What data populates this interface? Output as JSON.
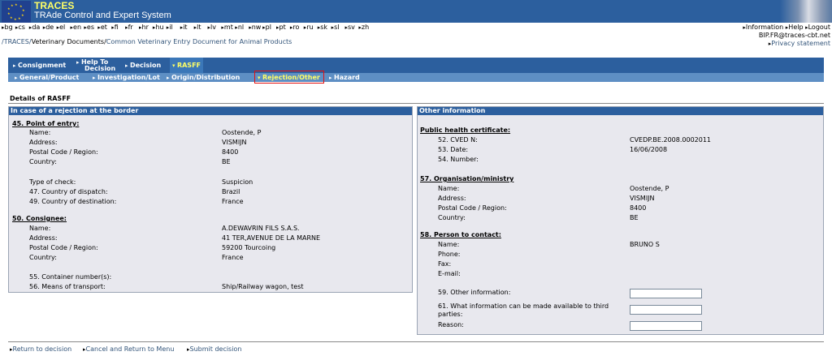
{
  "header": {
    "app_name": "TRACES",
    "app_subtitle": "TRAde Control and Expert System"
  },
  "languages": [
    "bg",
    "cs",
    "da",
    "de",
    "el",
    "en",
    "es",
    "et",
    "fi",
    "fr",
    "hr",
    "hu",
    "il",
    "it",
    "lt",
    "lv",
    "mt",
    "nl",
    "nw",
    "pl",
    "pt",
    "ro",
    "ru",
    "sk",
    "sl",
    "sv",
    "zh"
  ],
  "top_links": {
    "information": "Information",
    "help": "Help",
    "logout": "Logout",
    "user_email": "BIP.FR@traces-cbt.net",
    "privacy": "Privacy statement"
  },
  "breadcrumb": {
    "root": "/TRACES/",
    "section": "Veterinary Documents",
    "sep": "/",
    "page": "Common Veterinary Entry Document for Animal Products"
  },
  "tabs": {
    "consignment": "Consignment",
    "help_line1": "Help To",
    "help_line2": "Decision",
    "decision": "Decision",
    "rasff": "RASFF"
  },
  "subtabs": {
    "general": "General/Product",
    "investigation": "Investigation/Lot",
    "origin": "Origin/Distribution",
    "rejection": "Rejection/Other",
    "hazard": "Hazard"
  },
  "section_title": "Details of RASFF",
  "left_panel": {
    "title": "In case of a rejection at the border",
    "point_of_entry": {
      "heading": "45. Point of entry:",
      "name_label": "Name:",
      "name_value": "Oostende, P",
      "address_label": "Address:",
      "address_value": "VISMIJN",
      "postal_label": "Postal Code / Region:",
      "postal_value": "8400",
      "country_label": "Country:",
      "country_value": "BE"
    },
    "check": {
      "type_label": "Type of check:",
      "type_value": "Suspicion",
      "dispatch_label": "47. Country of dispatch:",
      "dispatch_value": "Brazil",
      "destination_label": "49. Country of destination:",
      "destination_value": "France"
    },
    "consignee": {
      "heading": "50. Consignee:",
      "name_label": "Name:",
      "name_value": "A.DEWAVRIN FILS S.A.S.",
      "address_label": "Address:",
      "address_value": "41 TER,AVENUE DE LA MARNE",
      "postal_label": "Postal Code / Region:",
      "postal_value": "59200 Tourcoing",
      "country_label": "Country:",
      "country_value": "France"
    },
    "transport": {
      "container_label": "55. Container number(s):",
      "means_label": "56. Means of transport:",
      "means_value": "Ship/Railway wagon, test"
    }
  },
  "right_panel": {
    "title": "Other information",
    "public_health": {
      "heading": "Public health certificate:",
      "cved_label": "52. CVED N:",
      "cved_value": "CVEDP.BE.2008.0002011",
      "date_label": "53. Date:",
      "date_value": "16/06/2008",
      "number_label": "54. Number:"
    },
    "organisation": {
      "heading": "57. Organisation/ministry",
      "name_label": "Name:",
      "name_value": "Oostende, P",
      "address_label": "Address:",
      "address_value": "VISMIJN",
      "postal_label": "Postal Code / Region:",
      "postal_value": "8400",
      "country_label": "Country:",
      "country_value": "BE"
    },
    "contact": {
      "heading": "58. Person to contact:",
      "name_label": "Name:",
      "name_value": "BRUNO S",
      "phone_label": "Phone:",
      "fax_label": "Fax:",
      "email_label": "E-mail:"
    },
    "other": {
      "other_info_label": "59. Other information:",
      "third_party_line1": "61. What information can be made available to third",
      "third_party_line2": "parties:",
      "reason_label": "Reason:",
      "other_info_value": "",
      "third_party_value": "",
      "reason_value": ""
    }
  },
  "bottom_links": {
    "return": "Return to decision",
    "cancel": "Cancel and Return to Menu",
    "submit": "Submit decision"
  }
}
